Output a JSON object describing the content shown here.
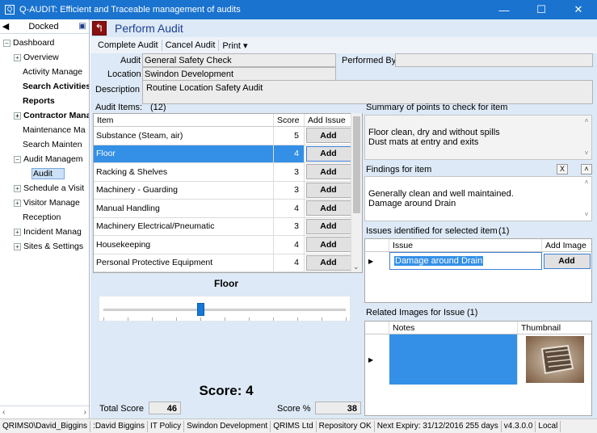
{
  "window": {
    "title": "Q-AUDIT: Efficient and Traceable management of audits",
    "minimize": "—",
    "maximize": "☐",
    "close": "✕"
  },
  "sidebar": {
    "dock_label": "Docked",
    "items": [
      {
        "label": "Dashboard",
        "level": 0,
        "expander": "−"
      },
      {
        "label": "Overview",
        "level": 1,
        "expander": "+"
      },
      {
        "label": "Activity Manage",
        "level": 1
      },
      {
        "label": "Search Activities",
        "level": 1,
        "bold": true
      },
      {
        "label": "Reports",
        "level": 1,
        "bold": true
      },
      {
        "label": "Contractor Mana",
        "level": 1,
        "expander": "+",
        "bold": true
      },
      {
        "label": "Maintenance Ma",
        "level": 1
      },
      {
        "label": "Search Mainten",
        "level": 1
      },
      {
        "label": "Audit Managem",
        "level": 1,
        "expander": "−"
      },
      {
        "label": "Audit",
        "level": 2,
        "selected": true
      },
      {
        "label": "Schedule a Visit",
        "level": 1,
        "expander": "+"
      },
      {
        "label": "Visitor Manage",
        "level": 1,
        "expander": "+"
      },
      {
        "label": "Reception",
        "level": 1
      },
      {
        "label": "Incident Manag",
        "level": 1,
        "expander": "+"
      },
      {
        "label": "Sites & Settings",
        "level": 1,
        "expander": "+"
      }
    ]
  },
  "page": {
    "title": "Perform Audit",
    "back_icon_glyph": "↰"
  },
  "toolbar": {
    "complete": "Complete Audit",
    "cancel": "Cancel Audit",
    "print": "Print ▾"
  },
  "form": {
    "audit_label": "Audit",
    "audit_value": "General Safety Check",
    "performed_by_label": "Performed By",
    "performed_by_value": "",
    "location_label": "Location",
    "location_value": "Swindon Development",
    "description_label": "Description",
    "description_value": "Routine Location Safety Audit"
  },
  "audit_items": {
    "label": "Audit Items:",
    "count": "(12)",
    "columns": {
      "item": "Item",
      "score": "Score",
      "add_issue": "Add Issue"
    },
    "rows": [
      {
        "item": "Substance (Steam, air)",
        "score": "5",
        "action": "Add"
      },
      {
        "item": "Floor",
        "score": "4",
        "action": "Add",
        "selected": true
      },
      {
        "item": "Racking & Shelves",
        "score": "3",
        "action": "Add"
      },
      {
        "item": "Machinery - Guarding",
        "score": "3",
        "action": "Add"
      },
      {
        "item": "Manual Handling",
        "score": "4",
        "action": "Add"
      },
      {
        "item": "Machinery Electrical/Pneumatic",
        "score": "3",
        "action": "Add"
      },
      {
        "item": "Housekeeping",
        "score": "4",
        "action": "Add"
      },
      {
        "item": "Personal Protective Equipment",
        "score": "4",
        "action": "Add"
      }
    ]
  },
  "selected_item": {
    "name": "Floor",
    "slider": {
      "min": 0,
      "max": 10,
      "value": 4
    }
  },
  "score": {
    "big_text": "Score: 4",
    "total_label": "Total Score",
    "total_value": "46",
    "percent_label": "Score %",
    "percent_value": "38"
  },
  "summary": {
    "label": "Summary of points to check for item",
    "text": "Floor clean, dry and without spills\nDust mats at entry and exits"
  },
  "findings": {
    "label": "Findings for item",
    "clear_glyph": "X",
    "collapse_glyph": "˄",
    "text": "Generally clean and well maintained.\nDamage around Drain"
  },
  "issues": {
    "label": "Issues identified for selected item",
    "count": "(1)",
    "columns": {
      "issue": "Issue",
      "add_image": "Add Image"
    },
    "rows": [
      {
        "issue": "Damage around Drain",
        "action": "Add"
      }
    ]
  },
  "images": {
    "label": "Related Images for Issue",
    "count": "(1)",
    "columns": {
      "notes": "Notes",
      "thumbnail": "Thumbnail"
    }
  },
  "statusbar": [
    "QRIMS0\\David_Biggins",
    ":David Biggins",
    "IT Policy",
    "Swindon Development",
    "QRIMS Ltd",
    "Repository OK",
    "Next Expiry: 31/12/2016   255 days",
    "v4.3.0.0",
    "Local"
  ],
  "colors": {
    "titlebar": "#1a73cf",
    "selection": "#3490e6",
    "panel_bg": "#dde9f6",
    "slider_thumb": "#1479d8"
  }
}
